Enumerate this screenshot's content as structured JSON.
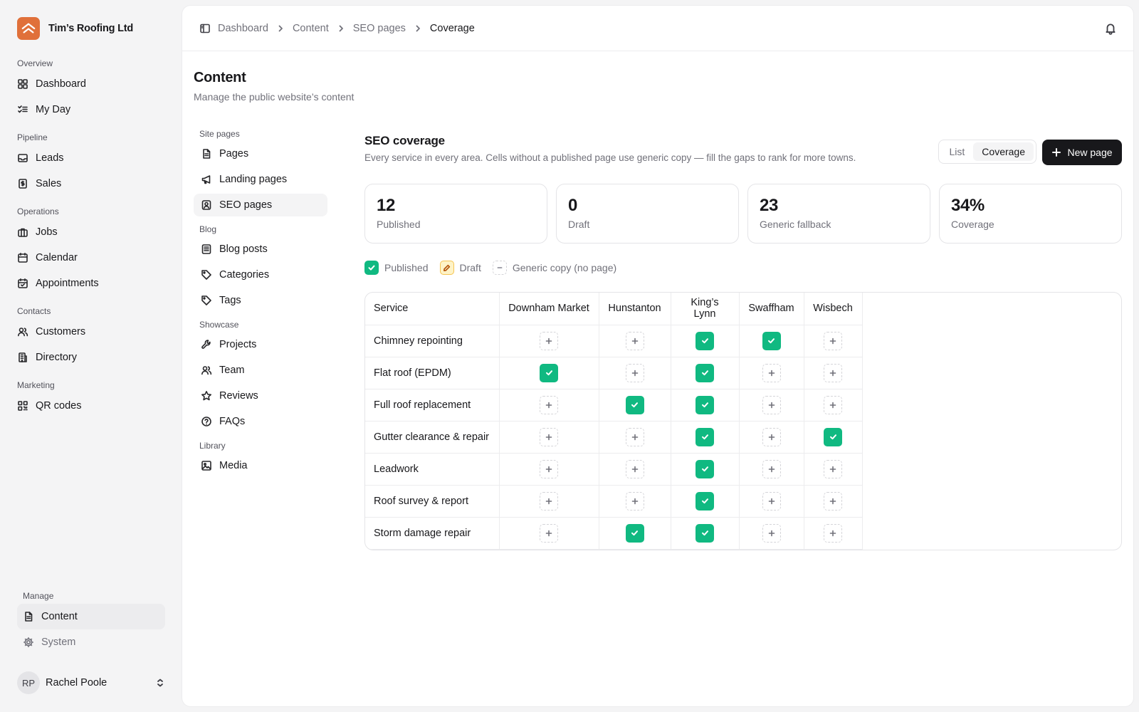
{
  "brand": {
    "name": "Tim’s Roofing Ltd",
    "color": "#e0703a"
  },
  "sidebar": {
    "groups": [
      {
        "label": "Overview",
        "items": [
          {
            "label": "Dashboard",
            "icon": "grid-icon"
          },
          {
            "label": "My Day",
            "icon": "list-check-icon"
          }
        ]
      },
      {
        "label": "Pipeline",
        "items": [
          {
            "label": "Leads",
            "icon": "inbox-icon"
          },
          {
            "label": "Sales",
            "icon": "dollar-receipt-icon"
          }
        ]
      },
      {
        "label": "Operations",
        "items": [
          {
            "label": "Jobs",
            "icon": "briefcase-icon"
          },
          {
            "label": "Calendar",
            "icon": "calendar-icon"
          },
          {
            "label": "Appointments",
            "icon": "calendar-check-icon"
          }
        ]
      },
      {
        "label": "Contacts",
        "items": [
          {
            "label": "Customers",
            "icon": "users-icon"
          },
          {
            "label": "Directory",
            "icon": "building-icon"
          }
        ]
      },
      {
        "label": "Marketing",
        "items": [
          {
            "label": "QR codes",
            "icon": "qr-code-icon"
          }
        ]
      }
    ],
    "manage": {
      "label": "Manage",
      "items": [
        {
          "label": "Content",
          "icon": "file-text-icon",
          "active": true
        },
        {
          "label": "System",
          "icon": "gear-icon"
        }
      ]
    },
    "user": {
      "initials": "RP",
      "name": "Rachel Poole"
    }
  },
  "breadcrumb": [
    "Dashboard",
    "Content",
    "SEO pages",
    "Coverage"
  ],
  "page": {
    "title": "Content",
    "subtitle": "Manage the public website’s content"
  },
  "subnav": {
    "groups": [
      {
        "label": "Site pages",
        "items": [
          {
            "label": "Pages",
            "icon": "file-icon"
          },
          {
            "label": "Landing pages",
            "icon": "megaphone-icon"
          },
          {
            "label": "SEO pages",
            "icon": "map-pin-user-icon",
            "active": true
          }
        ]
      },
      {
        "label": "Blog",
        "items": [
          {
            "label": "Blog posts",
            "icon": "newspaper-icon"
          },
          {
            "label": "Categories",
            "icon": "tag-icon"
          },
          {
            "label": "Tags",
            "icon": "tag-icon"
          }
        ]
      },
      {
        "label": "Showcase",
        "items": [
          {
            "label": "Projects",
            "icon": "wrench-icon"
          },
          {
            "label": "Team",
            "icon": "users-icon"
          },
          {
            "label": "Reviews",
            "icon": "star-icon"
          },
          {
            "label": "FAQs",
            "icon": "help-circle-icon"
          }
        ]
      },
      {
        "label": "Library",
        "items": [
          {
            "label": "Media",
            "icon": "image-icon"
          }
        ]
      }
    ]
  },
  "seo": {
    "title": "SEO coverage",
    "description": "Every service in every area. Cells without a published page use generic copy — fill the gaps to rank for more towns.",
    "view_options": [
      "List",
      "Coverage"
    ],
    "active_view": "Coverage",
    "new_button": "New page",
    "stats": [
      {
        "value": "12",
        "label": "Published"
      },
      {
        "value": "0",
        "label": "Draft"
      },
      {
        "value": "23",
        "label": "Generic fallback"
      },
      {
        "value": "34%",
        "label": "Coverage"
      }
    ],
    "legend": [
      {
        "label": "Published",
        "kind": "pub"
      },
      {
        "label": "Draft",
        "kind": "draft"
      },
      {
        "label": "Generic copy (no page)",
        "kind": "gen"
      }
    ],
    "colors": {
      "published": "#10b981",
      "draft_bg": "#fef3c7",
      "draft_border": "#f5c451"
    },
    "table": {
      "service_header": "Service",
      "towns": [
        "Downham Market",
        "Hunstanton",
        "King’s Lynn",
        "Swaffham",
        "Wisbech"
      ],
      "rows": [
        {
          "service": "Chimney repointing",
          "cells": [
            "gen",
            "gen",
            "pub",
            "pub",
            "gen"
          ]
        },
        {
          "service": "Flat roof (EPDM)",
          "cells": [
            "pub",
            "gen",
            "pub",
            "gen",
            "gen"
          ]
        },
        {
          "service": "Full roof replacement",
          "cells": [
            "gen",
            "pub",
            "pub",
            "gen",
            "gen"
          ]
        },
        {
          "service": "Gutter clearance & repair",
          "cells": [
            "gen",
            "gen",
            "pub",
            "gen",
            "pub"
          ]
        },
        {
          "service": "Leadwork",
          "cells": [
            "gen",
            "gen",
            "pub",
            "gen",
            "gen"
          ]
        },
        {
          "service": "Roof survey & report",
          "cells": [
            "gen",
            "gen",
            "pub",
            "gen",
            "gen"
          ]
        },
        {
          "service": "Storm damage repair",
          "cells": [
            "gen",
            "pub",
            "pub",
            "gen",
            "gen"
          ]
        }
      ]
    }
  }
}
